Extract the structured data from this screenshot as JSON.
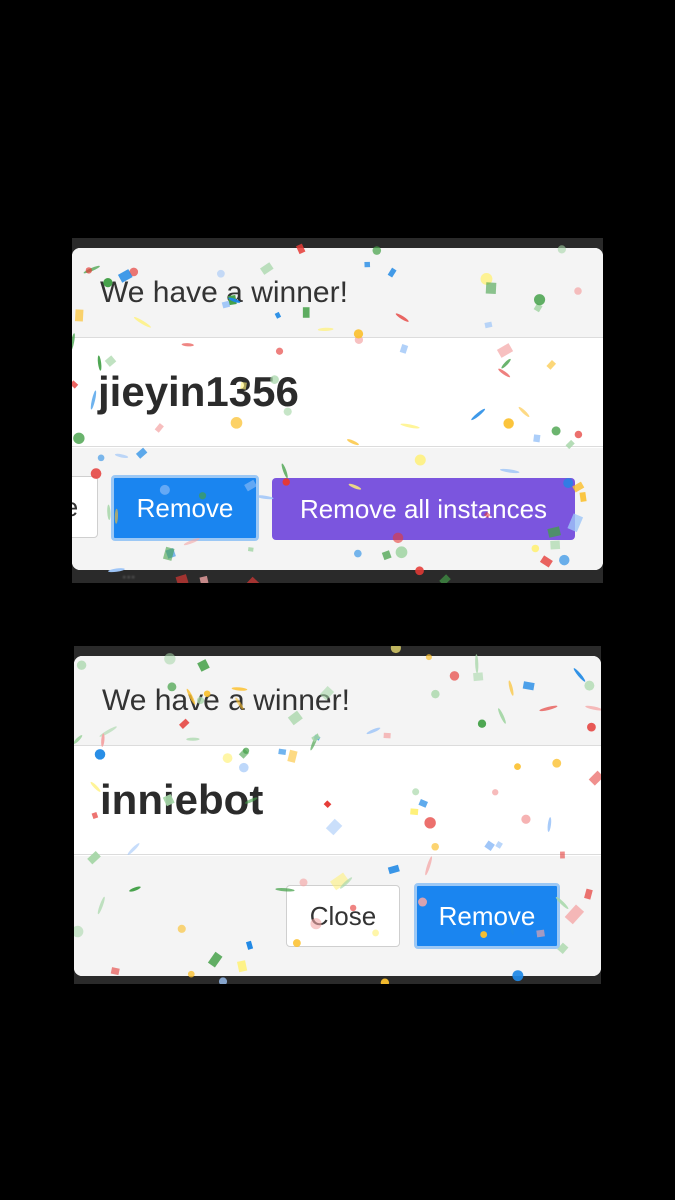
{
  "screens": [
    {
      "title": "We have a winner!",
      "winner": "jieyin1356",
      "buttons": {
        "close": "Close",
        "remove": "Remove",
        "remove_all": "Remove all instances"
      }
    },
    {
      "title": "We have a winner!",
      "winner": "inniebot",
      "buttons": {
        "close": "Close",
        "remove": "Remove"
      }
    }
  ],
  "confetti_colors": [
    "#e53935",
    "#1e88e5",
    "#43a047",
    "#fbc02d",
    "#f4a6a6",
    "#9ec5f8",
    "#a5d6a7",
    "#fff176"
  ]
}
